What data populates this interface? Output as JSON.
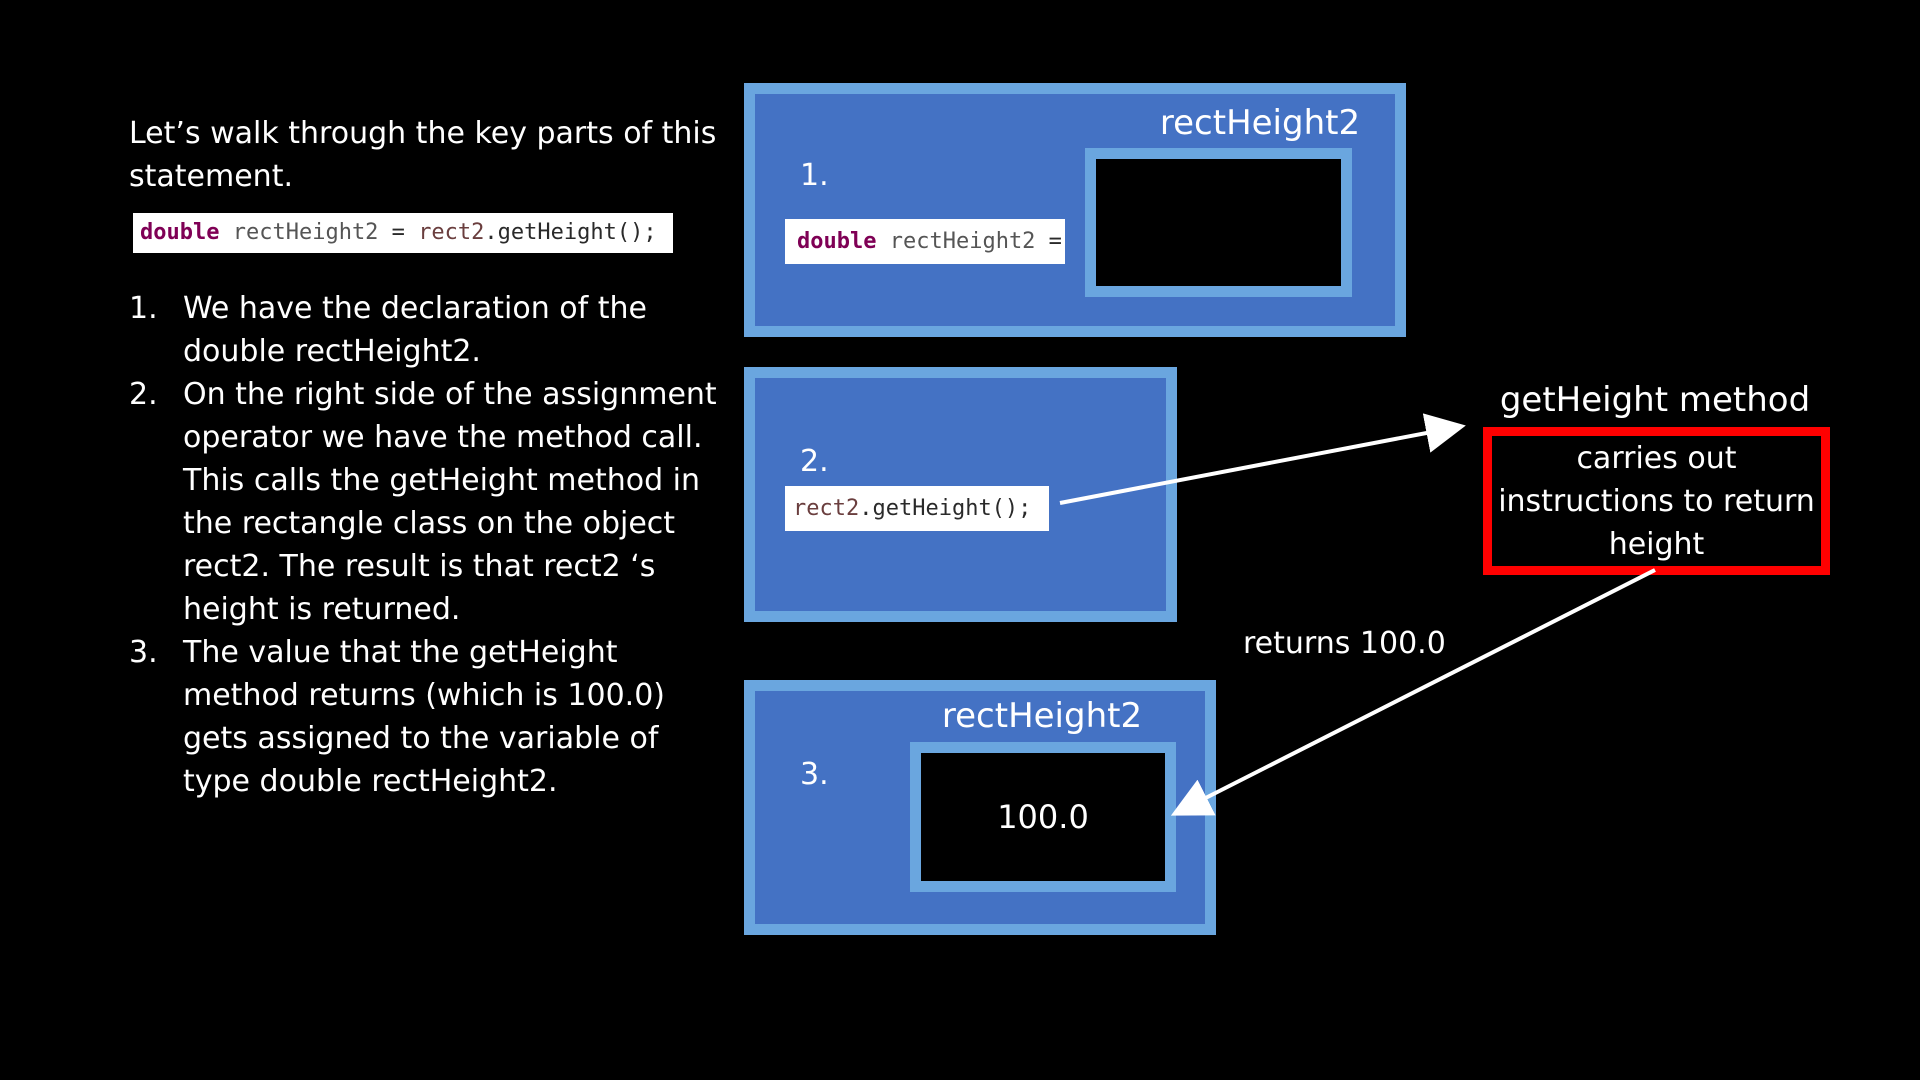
{
  "intro": {
    "text": "Let’s walk through the key parts of this statement."
  },
  "statement_code": {
    "keyword": "double",
    "variable": "rectHeight2",
    "assign": " = ",
    "object": "rect2",
    "call": ".getHeight();"
  },
  "steps": [
    {
      "num": "1.",
      "text": "We have the declaration of the double rectHeight2."
    },
    {
      "num": "2.",
      "text": "On the right side of the assignment operator we have the method call. This calls the getHeight method in the rectangle class on the object rect2. The result is that rect2 ‘s height is returned."
    },
    {
      "num": "3.",
      "text": "The value that the getHeight method returns (which is 100.0) gets assigned to the variable of type double rectHeight2."
    }
  ],
  "panel1": {
    "num": "1.",
    "var_label": "rectHeight2",
    "code_keyword": "double",
    "code_variable": "rectHeight2",
    "code_cut": " ="
  },
  "panel2": {
    "num": "2.",
    "code_object": "rect2",
    "code_call": ".getHeight();"
  },
  "panel3": {
    "num": "3.",
    "var_label": "rectHeight2",
    "value": "100.0"
  },
  "method": {
    "title": "getHeight method",
    "description": "carries out instructions to return height"
  },
  "returns_label": "returns 100.0",
  "colors": {
    "panel_fill": "#4472c4",
    "panel_border": "#6aa6df",
    "method_border": "#ff0000",
    "background": "#000000",
    "keyword": "#7f0055"
  }
}
